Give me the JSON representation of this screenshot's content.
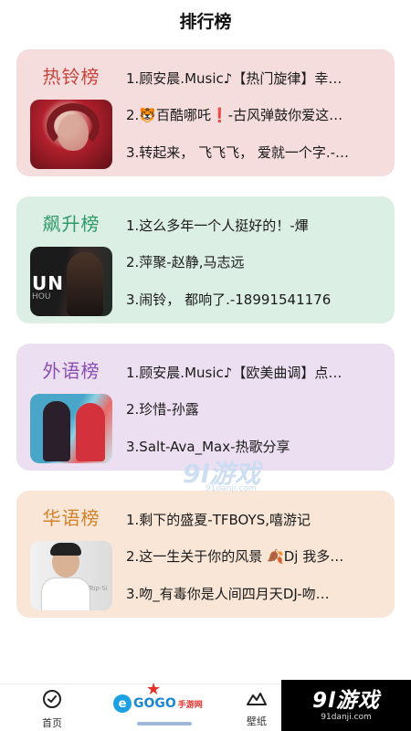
{
  "header": {
    "title": "排行榜"
  },
  "charts": [
    {
      "title": "热铃榜",
      "title_color": "#c6473e",
      "bg_color": "#f5dcdd",
      "cover_icon": "album-cover",
      "songs": [
        "1.顾安晨.Music♪【热门旋律】幸…",
        "2.🐯百酷哪吒❗-古风弹鼓你爱这…",
        "3.转起来， 飞飞飞， 爱就一个字.-…"
      ]
    },
    {
      "title": "飙升榜",
      "title_color": "#2e9a6a",
      "bg_color": "#dcefe4",
      "cover_icon": "album-cover",
      "cover_text": "UN",
      "cover_sub": "HOU",
      "songs": [
        "1.这么多年一个人挺好的！-熚",
        "2.萍聚-赵静,马志远",
        "3.闹铃， 都响了.-18991541176"
      ]
    },
    {
      "title": "外语榜",
      "title_color": "#8a4fb0",
      "bg_color": "#ecdff2",
      "cover_icon": "album-cover",
      "songs": [
        "1.顾安晨.Music♪【欧美曲调】点…",
        "2.珍惜-孙露",
        "3.Salt-Ava_Max-热歌分享"
      ]
    },
    {
      "title": "华语榜",
      "title_color": "#d1822b",
      "bg_color": "#f9e6d6",
      "cover_icon": "album-cover",
      "cover_tag": "Top-Si",
      "songs": [
        "1.剩下的盛夏-TFBOYS,嘻游记",
        "2.这一生关于你的风景 🍂Dj 我多…",
        "3.吻_有毒你是人间四月天DJ-吻…"
      ]
    }
  ],
  "watermark": {
    "main": "9l游戏",
    "sub": "91danji.com"
  },
  "tabbar": {
    "home_label": "首页",
    "wallpaper_label": "壁纸",
    "gogo_e": "e",
    "gogo_text": "GOGO",
    "gogo_cn": "手游网"
  },
  "brand": {
    "main": "9l游戏",
    "url": "91danji.com"
  }
}
